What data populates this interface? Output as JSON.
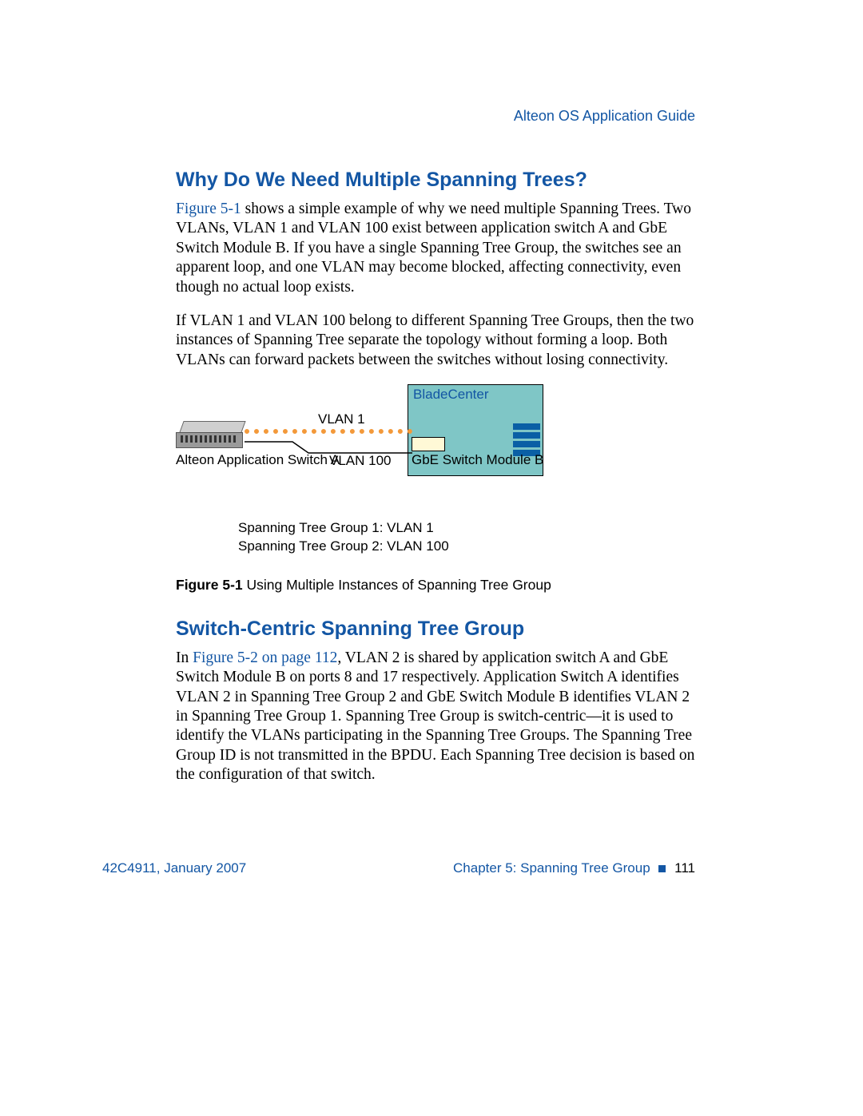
{
  "header": {
    "running": "Alteon OS  Application Guide"
  },
  "section1": {
    "heading": "Why Do We Need Multiple Spanning Trees?",
    "para1_xref": "Figure 5-1",
    "para1_rest": " shows a simple example of why we need multiple Spanning Trees. Two VLANs, VLAN 1 and VLAN 100 exist between application switch A and GbE Switch Module B. If you have a single Spanning Tree Group, the switches see an apparent loop, and one VLAN may become blocked, affecting connectivity, even though no actual loop exists.",
    "para2": "If VLAN 1 and VLAN 100 belong to different Spanning Tree Groups, then the two instances of Spanning Tree separate the topology without forming a loop. Both VLANs can forward packets between the switches without losing connectivity."
  },
  "figure": {
    "bladecenter_label": "BladeCenter",
    "vlan1": "VLAN 1",
    "vlan100": "VLAN 100",
    "switchA": "Alteon Application Switch A",
    "gbe": "GbE Switch Module B",
    "stg1": "Spanning Tree Group 1:  VLAN 1",
    "stg2": "Spanning Tree Group 2:  VLAN 100",
    "caption_num": "Figure 5-1",
    "caption_text": "  Using Multiple Instances of Spanning Tree Group"
  },
  "section2": {
    "heading": "Switch-Centric Spanning Tree Group",
    "para1_pre": "In ",
    "para1_xref": "Figure 5-2 on page 112",
    "para1_rest": ", VLAN 2 is shared by application switch A and GbE Switch Module B on ports 8 and 17 respectively. Application Switch A identifies VLAN 2 in Spanning Tree Group 2 and GbE Switch Module B identifies VLAN 2 in Spanning Tree Group 1. Spanning Tree Group is switch-centric—it is used to identify the VLANs participating in the Spanning Tree Groups. The Spanning Tree Group ID is not transmitted in the BPDU. Each Spanning Tree decision is based on the configuration of that switch."
  },
  "footer": {
    "left": "42C4911, January 2007",
    "chapter": "Chapter 5:  Spanning Tree Group",
    "page": "111"
  }
}
